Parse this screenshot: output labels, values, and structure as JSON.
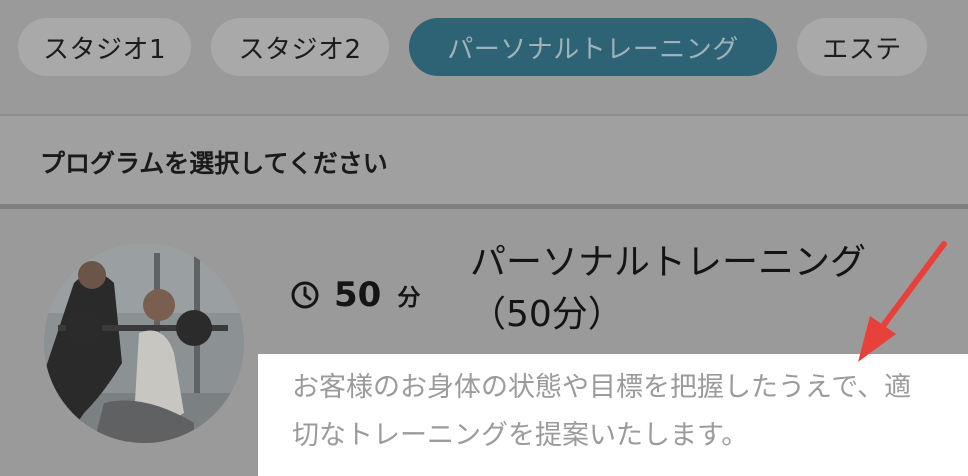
{
  "tabs": [
    {
      "label": "スタジオ1",
      "active": false
    },
    {
      "label": "スタジオ2",
      "active": false
    },
    {
      "label": "パーソナルトレーニング",
      "active": true
    },
    {
      "label": "エステ",
      "active": false
    }
  ],
  "section": {
    "title": "プログラムを選択してください"
  },
  "program": {
    "duration_value": "50",
    "duration_unit": "分",
    "title": "パーソナルトレーニング（50分）",
    "description": "お客様のお身体の状態や目標を把握したうえで、適切なトレーニングを提案いたします。"
  },
  "colors": {
    "overlay_bg": "#9a9a9a",
    "active_tab": "#2d6375",
    "arrow": "#e8403a",
    "highlight_box": "#ffffff"
  },
  "icons": [
    "clock-icon",
    "annotation-arrow"
  ]
}
